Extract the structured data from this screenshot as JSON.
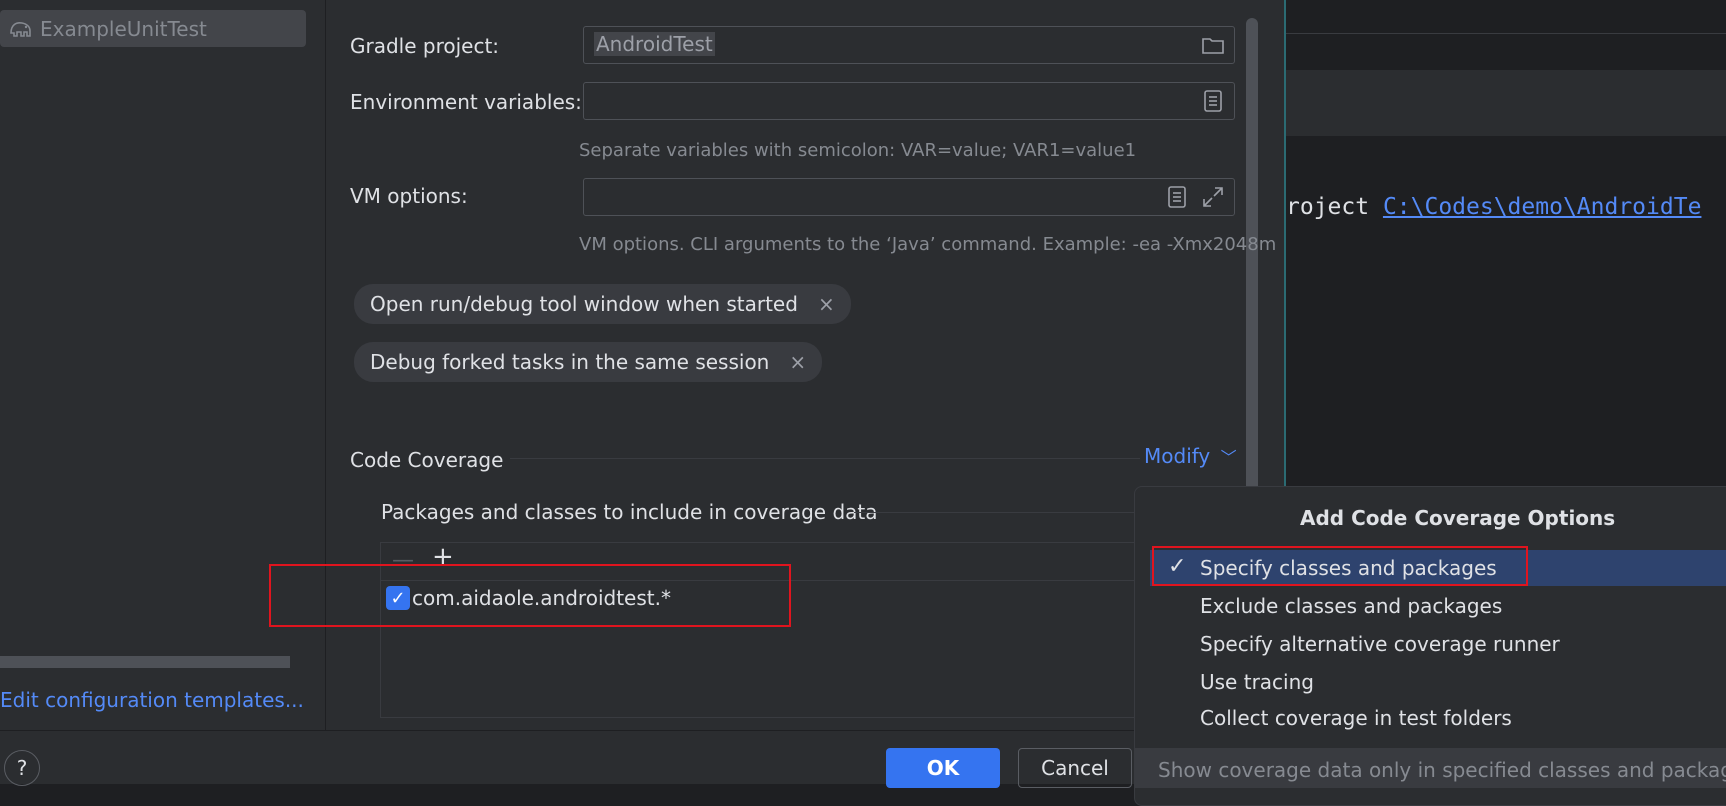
{
  "sidebar": {
    "tree_item": "ExampleUnitTest",
    "edit_templates": "Edit configuration templates..."
  },
  "form": {
    "gradle_project_label": "Gradle project:",
    "gradle_project_value": "AndroidTest",
    "env_vars_label": "Environment variables:",
    "env_vars_value": "",
    "env_vars_hint": "Separate variables with semicolon: VAR=value; VAR1=value1",
    "vm_options_label": "VM options:",
    "vm_options_value": "",
    "vm_options_hint": "VM options. CLI arguments to the ‘Java’ command. Example: -ea -Xmx2048m"
  },
  "chips": [
    "Open run/debug tool window when started",
    "Debug forked tasks in the same session"
  ],
  "coverage": {
    "section_label": "Code Coverage",
    "modify_label": "Modify",
    "packages_label": "Packages and classes to include in coverage data",
    "entry": "com.aidaole.androidtest.*",
    "entry_checked": true
  },
  "popup": {
    "title": "Add Code Coverage Options",
    "items": [
      "Specify classes and packages",
      "Exclude classes and packages",
      "Specify alternative coverage runner",
      "Use tracing",
      "Collect coverage in test folders"
    ],
    "selected_item": "Specify classes and packages",
    "footer": "Show coverage data only in specified classes and packages"
  },
  "console": {
    "prefix": "roject ",
    "link": "C:\\Codes\\demo\\AndroidTe"
  },
  "buttons": {
    "ok": "OK",
    "cancel": "Cancel",
    "help": "?"
  },
  "colors": {
    "accent": "#3574f0",
    "link": "#548af7",
    "highlight_box": "#e0141e",
    "selection": "#2e436e"
  }
}
